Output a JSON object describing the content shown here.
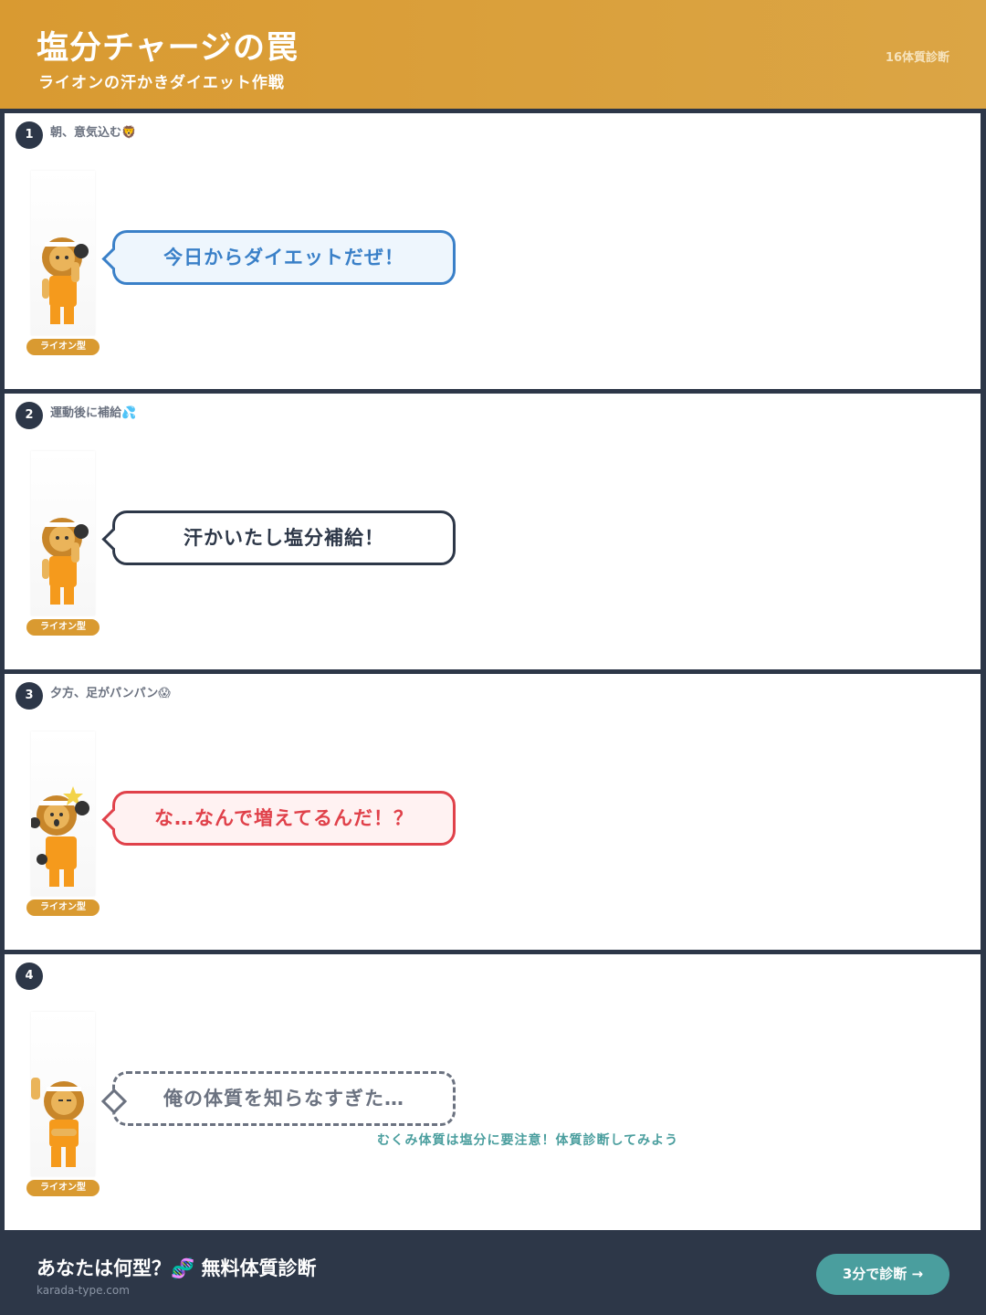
{
  "header": {
    "title": "塩分チャージの罠",
    "subtitle": "ライオンの汗かきダイエット作戦",
    "brand": "16体質診断"
  },
  "panels": [
    {
      "number": "1",
      "caption": "朝、意気込む🦁",
      "badge": "ライオン型",
      "speech": "今日からダイエットだぜ！"
    },
    {
      "number": "2",
      "caption": "運動後に補給💦",
      "badge": "ライオン型",
      "speech": "汗かいたし塩分補給！"
    },
    {
      "number": "3",
      "caption": "夕方、足がパンパン😱",
      "badge": "ライオン型",
      "speech": "な…なんで増えてるんだ！？"
    },
    {
      "number": "4",
      "caption": "",
      "badge": "ライオン型",
      "speech": "俺の体質を知らなすぎた…",
      "hint": "むくみ体質は塩分に要注意！体質診断してみよう"
    }
  ],
  "footer": {
    "title": "あなたは何型？🧬 無料体質診断",
    "url": "karada-type.com",
    "cta": "3分で診断 →"
  },
  "colors": {
    "header": "#d99a31",
    "dark": "#2d3748",
    "teal": "#4a9e9e",
    "blue": "#3a80c8",
    "red": "#e0414a"
  }
}
